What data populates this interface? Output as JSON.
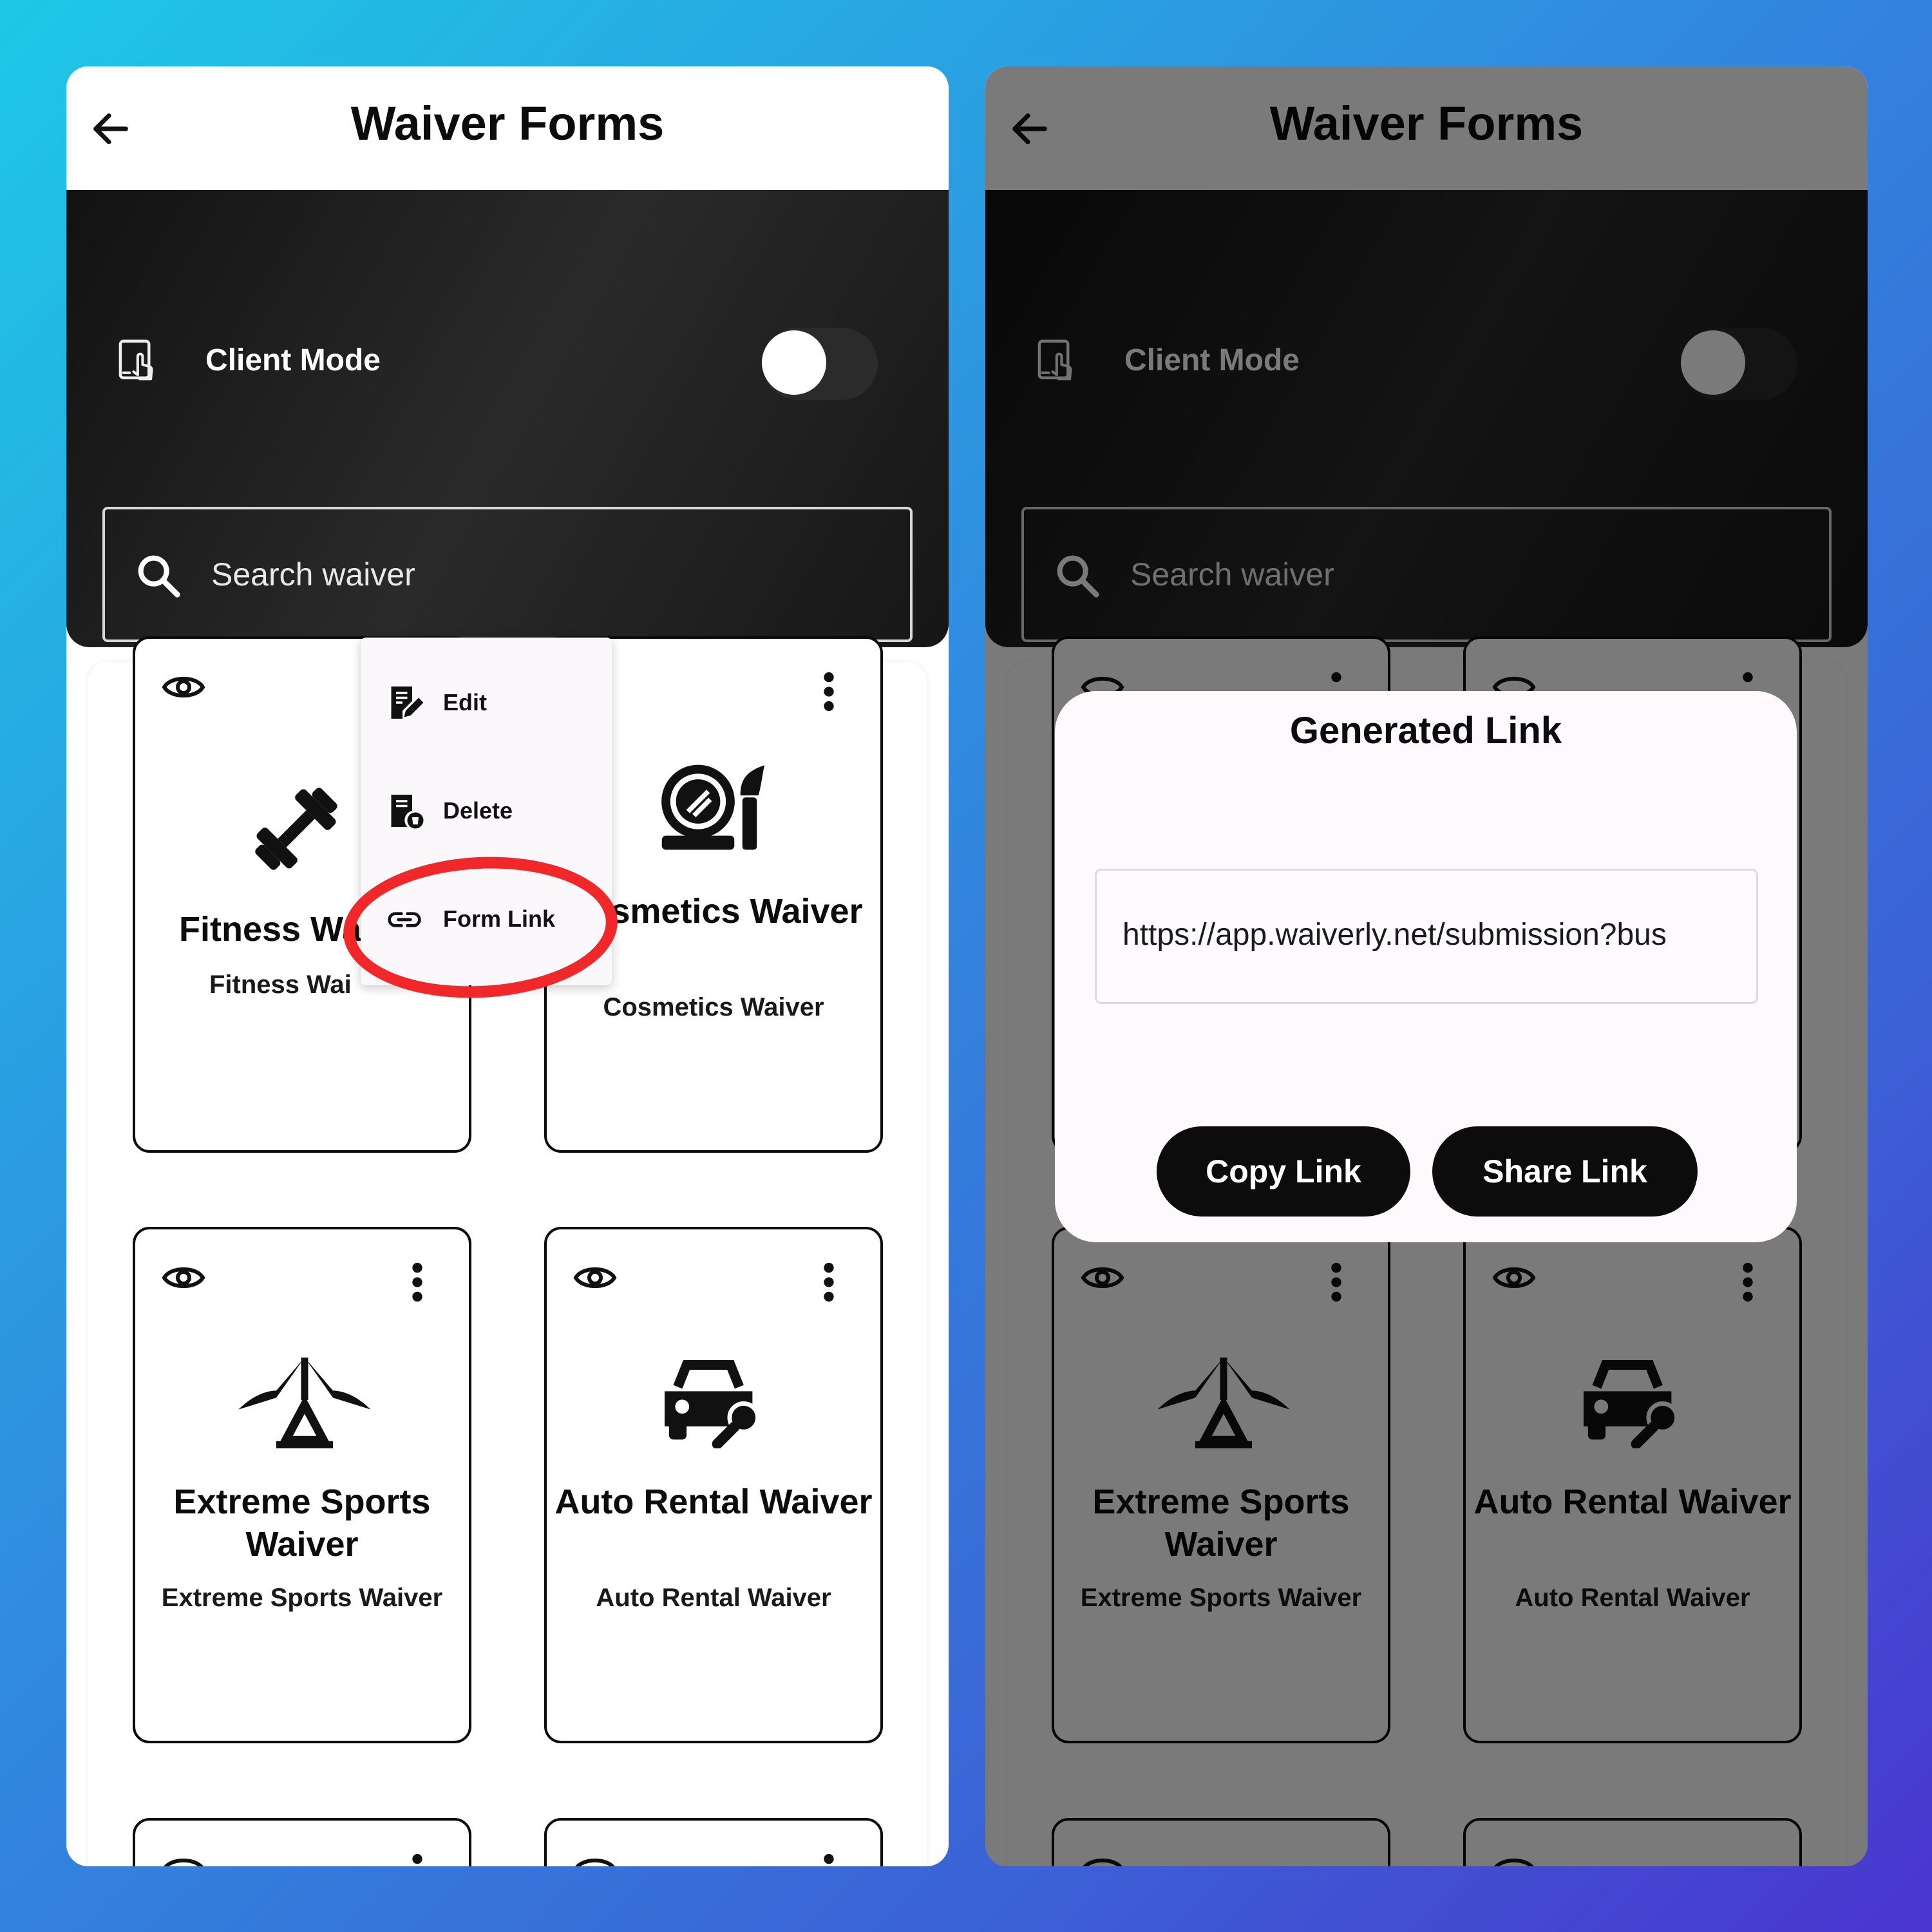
{
  "header": {
    "title": "Waiver Forms"
  },
  "client_mode": {
    "label": "Client Mode",
    "enabled": false
  },
  "search": {
    "placeholder": "Search waiver"
  },
  "cards": [
    {
      "title": "Fitness Waiver",
      "title_visible": "Fitness Wa",
      "subtitle": "Fitness Waiver",
      "subtitle_visible": "Fitness Wai",
      "icon": "dumbbell-icon"
    },
    {
      "title": "Cosmetics Waiver",
      "subtitle": "Cosmetics Waiver",
      "icon": "cosmetics-icon"
    },
    {
      "title": "Extreme Sports Waiver",
      "subtitle": "Extreme Sports Waiver",
      "icon": "hang-glider-icon"
    },
    {
      "title": "Auto Rental Waiver",
      "subtitle": "Auto Rental Waiver",
      "icon": "car-key-icon"
    }
  ],
  "context_menu": {
    "items": [
      {
        "label": "Edit",
        "icon": "edit-document-icon"
      },
      {
        "label": "Delete",
        "icon": "delete-document-icon"
      },
      {
        "label": "Form Link",
        "icon": "link-icon"
      }
    ]
  },
  "dialog": {
    "title": "Generated Link",
    "link": "https://app.waiverly.net/submission?bus",
    "copy_label": "Copy Link",
    "share_label": "Share Link"
  },
  "colors": {
    "highlight_ring": "#f0282a",
    "button_bg": "#0c0c0c",
    "dark_panel": "#1c1c1c"
  }
}
